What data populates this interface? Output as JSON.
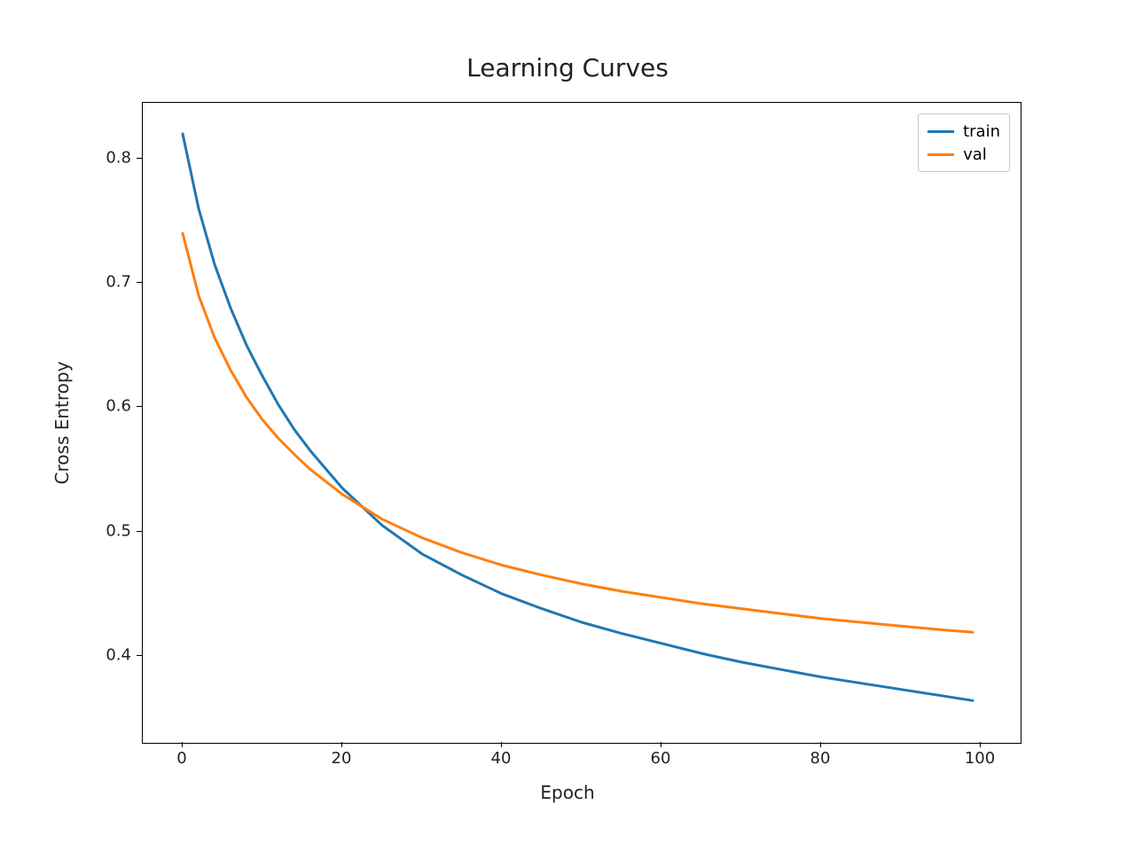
{
  "chart_data": {
    "type": "line",
    "title": "Learning Curves",
    "xlabel": "Epoch",
    "ylabel": "Cross Entropy",
    "xlim": [
      -5,
      105
    ],
    "ylim": [
      0.33,
      0.845
    ],
    "xticks": [
      0,
      20,
      40,
      60,
      80,
      100
    ],
    "yticks": [
      0.4,
      0.5,
      0.6,
      0.7,
      0.8
    ],
    "legend_pos": "upper right",
    "series": [
      {
        "name": "train",
        "color": "#1f77b4",
        "x": [
          0,
          2,
          4,
          6,
          8,
          10,
          12,
          14,
          16,
          18,
          20,
          25,
          30,
          35,
          40,
          45,
          50,
          55,
          60,
          65,
          70,
          75,
          80,
          85,
          90,
          95,
          99
        ],
        "y": [
          0.82,
          0.76,
          0.715,
          0.68,
          0.65,
          0.625,
          0.602,
          0.582,
          0.565,
          0.55,
          0.535,
          0.505,
          0.482,
          0.465,
          0.45,
          0.438,
          0.427,
          0.418,
          0.41,
          0.402,
          0.395,
          0.389,
          0.383,
          0.378,
          0.373,
          0.368,
          0.364
        ]
      },
      {
        "name": "val",
        "color": "#ff7f0e",
        "x": [
          0,
          2,
          4,
          6,
          8,
          10,
          12,
          14,
          16,
          18,
          20,
          25,
          30,
          35,
          40,
          45,
          50,
          55,
          60,
          65,
          70,
          75,
          80,
          85,
          90,
          95,
          99
        ],
        "y": [
          0.74,
          0.69,
          0.656,
          0.63,
          0.608,
          0.59,
          0.575,
          0.562,
          0.55,
          0.54,
          0.53,
          0.51,
          0.495,
          0.483,
          0.473,
          0.465,
          0.458,
          0.452,
          0.447,
          0.442,
          0.438,
          0.434,
          0.43,
          0.427,
          0.424,
          0.421,
          0.419
        ]
      }
    ]
  }
}
